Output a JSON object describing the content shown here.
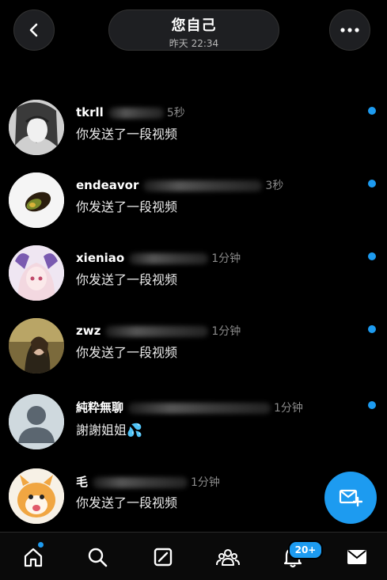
{
  "header": {
    "title": "您自己",
    "subtitle": "昨天 22:34"
  },
  "conversations": [
    {
      "name": "tkrll",
      "time": "5秒",
      "message": "你发送了一段视频"
    },
    {
      "name": "endeavor",
      "time": "3秒",
      "message": "你发送了一段视频"
    },
    {
      "name": "xieniao",
      "time": "1分钟",
      "message": "你发送了一段视频"
    },
    {
      "name": "zwz",
      "time": "1分钟",
      "message": "你发送了一段视频"
    },
    {
      "name": "純粋無聊",
      "time": "1分钟",
      "message": "謝謝姐姐💦"
    },
    {
      "name": "毛",
      "time": "1分钟",
      "message": "你发送了一段视频"
    }
  ],
  "nav": {
    "notifications_badge": "20+"
  },
  "colors": {
    "accent": "#1d9bf0",
    "background": "#000000"
  },
  "icons": [
    "back-icon",
    "more-icon",
    "home-icon",
    "search-icon",
    "grok-icon",
    "communities-icon",
    "bell-icon",
    "mail-icon",
    "new-message-icon"
  ]
}
